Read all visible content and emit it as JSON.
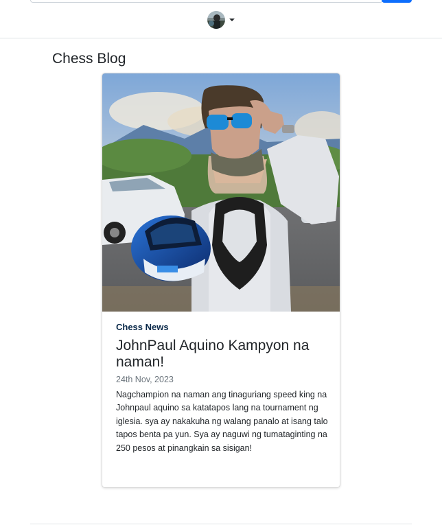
{
  "header": {
    "avatar_alt": "User avatar",
    "avatar_icon": "user-avatar-icon",
    "dropdown_icon": "caret-down-icon"
  },
  "page": {
    "title": "Chess Blog"
  },
  "post": {
    "category": "Chess News",
    "title": "JohnPaul Aquino Kampyon na naman!",
    "date": "24th Nov, 2023",
    "body": "Nagchampion na naman ang tinaguriang speed king na Johnpaul aquino sa katatapos lang na tournament ng iglesia. sya ay nakakuha ng walang panalo at isang talo tapos benta pa yun. Sya ay naguwi ng tumataginting na 250 pesos at pinangkain sa sisigan!",
    "image_alt": "Man in sunglasses holding a blue motorcycle helmet"
  },
  "colors": {
    "primary": "#0d6efd",
    "category": "#0b2a4a",
    "muted": "#6c757d",
    "border": "#dee2e6"
  }
}
